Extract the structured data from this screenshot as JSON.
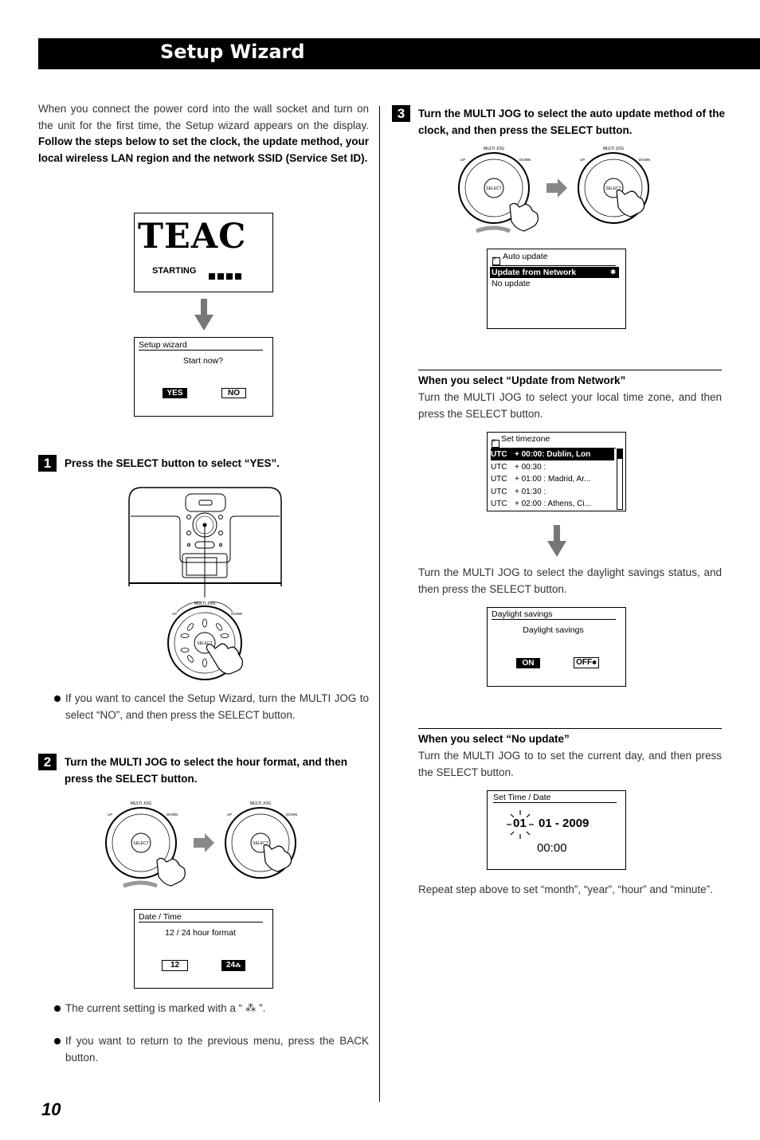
{
  "header": {
    "title": "Setup Wizard"
  },
  "intro": {
    "text_normal": "When you connect the power cord into the wall socket and turn on the unit for the first time, the Setup wizard appears on the display.",
    "text_bold": "Follow the steps below to set the clock, the update method, your local wireless LAN region and the network SSID (Service Set ID)."
  },
  "screens": {
    "startup": {
      "logo": "TEAC",
      "status": "STARTING"
    },
    "setup_wizard": {
      "title": "Setup wizard",
      "prompt": "Start now?",
      "yes": "YES",
      "no": "NO",
      "selected": "YES"
    },
    "date_time": {
      "title": "Date / Time",
      "prompt": "12 / 24 hour format",
      "opt1": "12",
      "opt2": "24",
      "selected": "24",
      "current_mark": "24"
    },
    "auto_update": {
      "icon": "menu-list-icon",
      "title": "Auto update",
      "items": [
        "Update from Network",
        "No update"
      ],
      "selected": "Update from Network"
    },
    "timezone": {
      "icon": "menu-list-icon",
      "title": "Set timezone",
      "rows": [
        {
          "utc": "UTC",
          "offset": "+ 00:00: Dublin, Lon"
        },
        {
          "utc": "UTC",
          "offset": "+ 00:30 :"
        },
        {
          "utc": "UTC",
          "offset": "+ 01:00 : Madrid, Ar..."
        },
        {
          "utc": "UTC",
          "offset": "+ 01:30 :"
        },
        {
          "utc": "UTC",
          "offset": "+ 02:00 : Athens, Ci..."
        }
      ],
      "selected_index": 0
    },
    "daylight": {
      "title": "Daylight savings",
      "prompt": "Daylight savings",
      "on": "ON",
      "off": "OFF",
      "selected": "ON",
      "current_mark": "OFF"
    },
    "set_time_date": {
      "title": "Set Time / Date",
      "day": "01",
      "rest": "01 - 2009",
      "time": "00:00"
    }
  },
  "steps": [
    {
      "num": "1",
      "text": "Press the SELECT button to select “YES”."
    },
    {
      "num": "2",
      "text": "Turn the MULTI JOG to select the hour format, and then press the SELECT button."
    },
    {
      "num": "3",
      "text": "Turn the MULTI JOG to select the auto update method of the clock, and then press the SELECT button."
    }
  ],
  "jog": {
    "label": "MULTI JOG",
    "up": "UP",
    "down": "DOWN",
    "center": "SELECT"
  },
  "notes": {
    "cancel": "If you want to cancel the Setup Wizard, turn the MULTI JOG to select “NO”, and then press the SELECT button.",
    "current_setting": "The current setting is marked with a “ ⁂ ”.",
    "back": "If you want to return to the previous menu, press the BACK button."
  },
  "network_section": {
    "heading": "When you select “Update from Network”",
    "text1": "Turn the MULTI JOG to select your local time zone, and then press the SELECT button.",
    "text2": "Turn the MULTI JOG to select the daylight savings status, and then press the SELECT button."
  },
  "noupdate_section": {
    "heading": "When you select “No update”",
    "text1": "Turn the MULTI JOG to to set the current day, and then press the SELECT button.",
    "text2": "Repeat step above to set “month”, “year”, “hour” and “minute”."
  },
  "footer": {
    "page_number": "10"
  }
}
